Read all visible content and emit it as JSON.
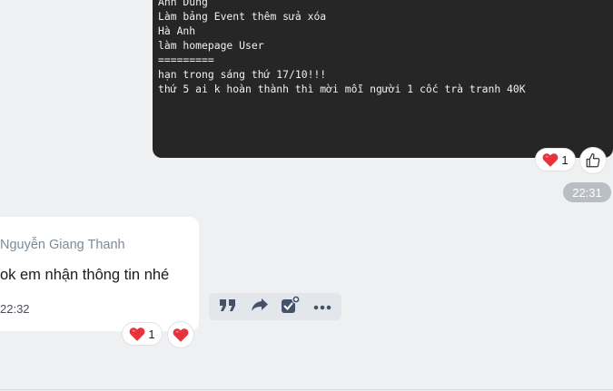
{
  "code_message": {
    "lines": [
      "Anh Dũng",
      "Làm bảng Event thêm sửa xóa",
      "Hà Anh",
      "làm homepage User",
      "=========",
      "hạn trong sáng thứ 17/10!!!",
      "thứ 5 ai k hoàn thành thì mời mỗi người 1 cốc trà tranh 40K"
    ],
    "reactions": [
      {
        "icon": "heart-icon",
        "count": "1"
      }
    ],
    "like_icon": "thumbs-up-icon",
    "time": "22:31"
  },
  "incoming_message": {
    "sender": "Nguyễn Giang Thanh",
    "text": "ok em nhận thông tin nhé",
    "time": "22:32",
    "reactions": [
      {
        "icon": "heart-icon",
        "count": "1"
      }
    ],
    "quick_reaction_icon": "heart-icon"
  },
  "actions": [
    {
      "icon": "quote-icon"
    },
    {
      "icon": "forward-icon"
    },
    {
      "icon": "add-task-icon"
    },
    {
      "icon": "more-icon"
    }
  ],
  "colors": {
    "background": "#eef0f2",
    "code_block": "#262626",
    "heart": "#e8323c",
    "time_pill": "#b9bdc4",
    "sender": "#7d8b99",
    "action_icon": "#44526a"
  }
}
